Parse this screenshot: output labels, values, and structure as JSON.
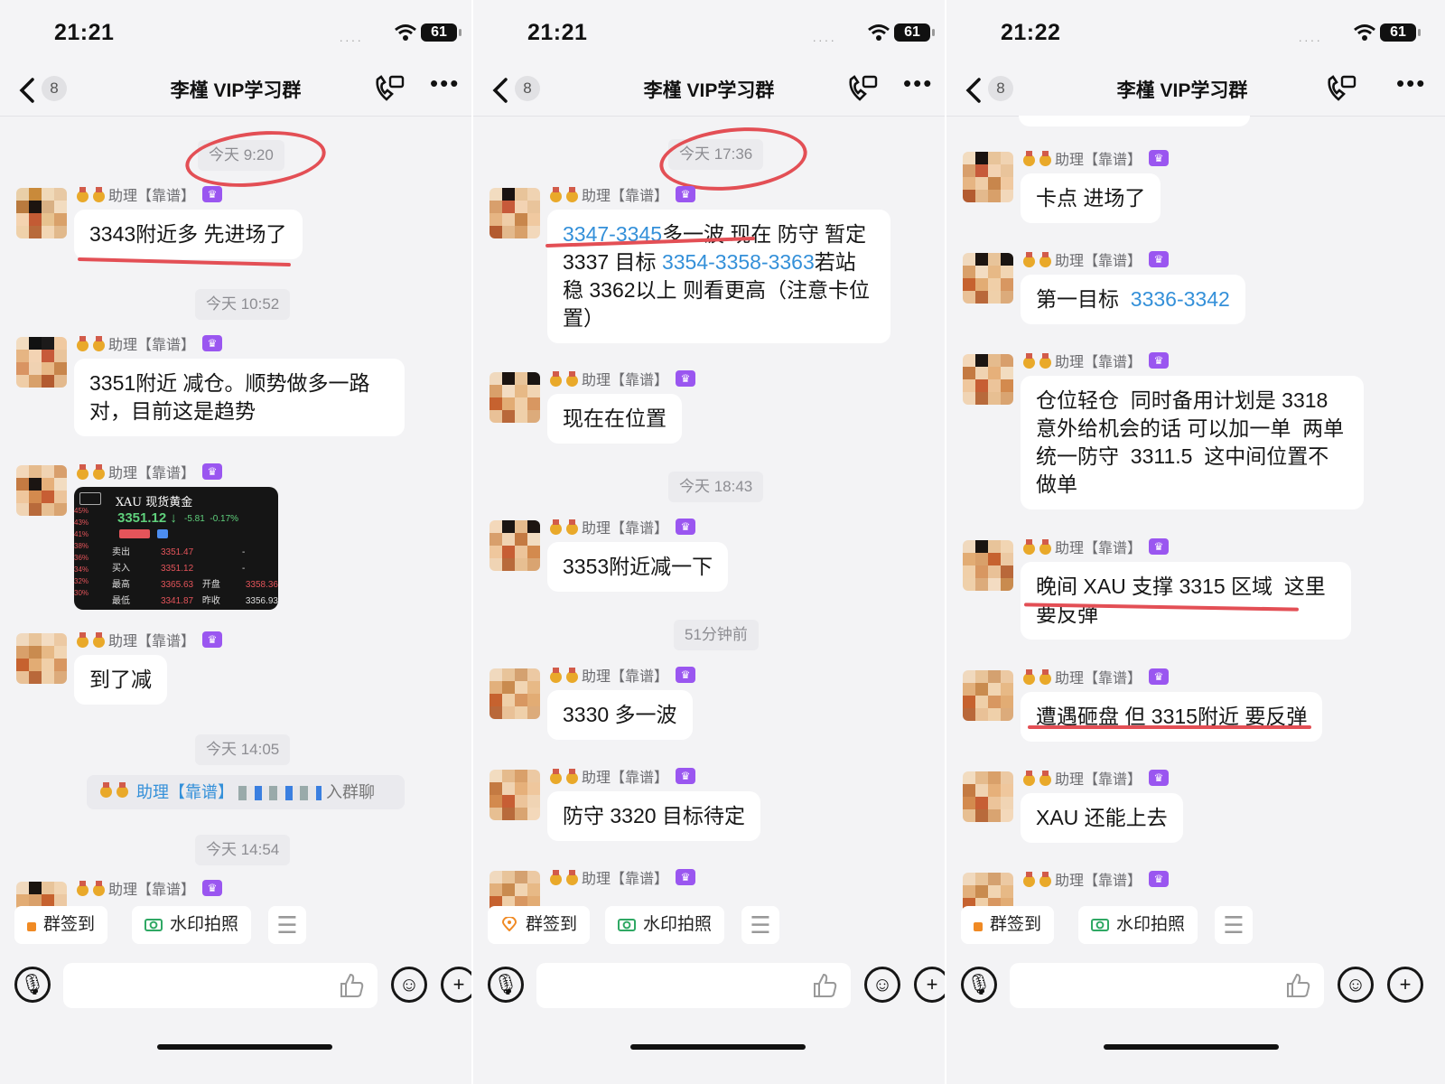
{
  "status_bar": [
    {
      "time": "21:21",
      "battery": "61"
    },
    {
      "time": "21:21",
      "battery": "61"
    },
    {
      "time": "21:22",
      "battery": "61"
    }
  ],
  "nav": {
    "title": "李槿 VIP学习群",
    "unread": "8"
  },
  "sender": "助理【靠谱】",
  "screen1": {
    "timestamps": [
      "今天 9:20",
      "今天 10:52",
      "今天 14:05",
      "今天 14:54"
    ],
    "messages": [
      "3343附近多 先进场了",
      "3351附近 减仓。顺势做多一路对，目前这是趋势",
      "到了减"
    ],
    "image_card": {
      "title": "XAU 现货黄金",
      "price": "3351.12",
      "change": "-5.81",
      "change_pct": "-0.17%",
      "rows": [
        {
          "label": "卖出",
          "value": "3351.47",
          "extra": "-"
        },
        {
          "label": "买入",
          "value": "3351.12",
          "extra": "-"
        },
        {
          "label": "最高",
          "value": "3365.63",
          "extra": "开盘",
          "extra_value": "3358.36"
        },
        {
          "label": "最低",
          "value": "3341.87",
          "extra": "昨收",
          "extra_value": "3356.93"
        }
      ],
      "side_labels": [
        "45%",
        "43%",
        "41%",
        "38%",
        "36%",
        "34%",
        "32%",
        "30%"
      ]
    },
    "join_notice": {
      "who": "助理【靠谱】",
      "action": "入群聊"
    }
  },
  "screen2": {
    "timestamps": [
      "今天 17:36",
      "今天 18:43",
      "51分钟前"
    ],
    "messages": [
      {
        "parts": [
          {
            "text": "3347-3345",
            "link": true
          },
          {
            "text": "多一波 现在 防守 暂定3337 目标 "
          },
          {
            "text": "3354-3358-3363",
            "link": true
          },
          {
            "text": "若站稳 3362以上 则看更高（注意卡位置）"
          }
        ]
      },
      {
        "parts": [
          {
            "text": "现在在位置"
          }
        ]
      },
      {
        "parts": [
          {
            "text": "3353附近减一下"
          }
        ]
      },
      {
        "parts": [
          {
            "text": "3330 多一波"
          }
        ]
      },
      {
        "parts": [
          {
            "text": "防守 3320 目标待定"
          }
        ]
      }
    ]
  },
  "screen3": {
    "messages": [
      {
        "parts": [
          {
            "text": "卡点 进场了"
          }
        ]
      },
      {
        "parts": [
          {
            "text": "第一目标  "
          },
          {
            "text": "3336-3342",
            "link": true
          }
        ]
      },
      {
        "parts": [
          {
            "text": "仓位轻仓  同时备用计划是 3318 意外给机会的话 可以加一单  两单 统一防守  3311.5  这中间位置不做单"
          }
        ]
      },
      {
        "parts": [
          {
            "text": "晚间 XAU 支撑 3315 区域  这里要反弹"
          }
        ]
      },
      {
        "parts": [
          {
            "text": "遭遇砸盘 但 3315附近 要反弹"
          }
        ]
      },
      {
        "parts": [
          {
            "text": "XAU 还能上去"
          }
        ]
      }
    ]
  },
  "quick_actions": {
    "checkin": "群签到",
    "watermark_photo": "水印拍照"
  },
  "colors": {
    "accent_link": "#3490d9",
    "annotation_red": "#e34f55",
    "vip_purple": "#9a56f0"
  }
}
